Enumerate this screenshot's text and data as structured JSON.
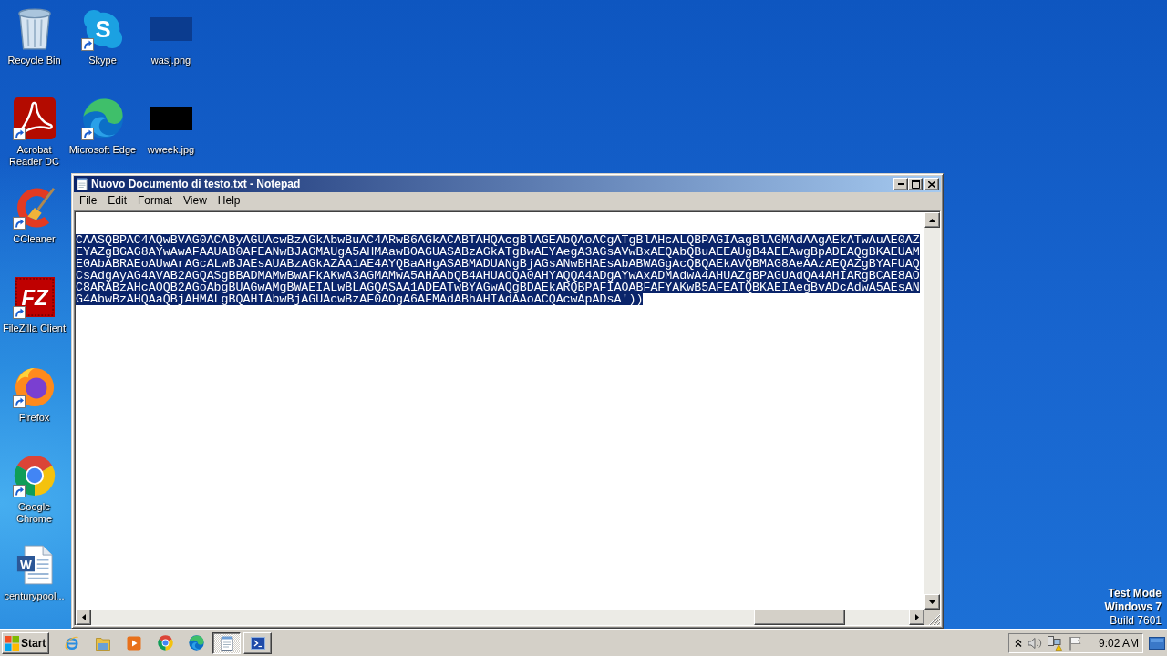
{
  "desktop": {
    "columns": [
      [
        {
          "label": "Recycle Bin",
          "kind": "bin",
          "shortcut": false
        },
        {
          "label": "Acrobat Reader DC",
          "kind": "acrobat",
          "shortcut": true
        },
        {
          "label": "CCleaner",
          "kind": "ccleaner",
          "shortcut": true
        },
        {
          "label": "FileZilla Client",
          "kind": "filezilla",
          "logo": "FZ",
          "shortcut": true
        },
        {
          "label": "Firefox",
          "kind": "firefox",
          "shortcut": true
        },
        {
          "label": "Google Chrome",
          "kind": "chrome",
          "shortcut": true
        },
        {
          "label": "centurypool...",
          "kind": "word",
          "logo": "W",
          "shortcut": false
        }
      ],
      [
        {
          "label": "Skype",
          "kind": "skype",
          "logo": "S",
          "shortcut": true
        },
        {
          "label": "Microsoft Edge",
          "kind": "edge",
          "shortcut": true
        }
      ],
      [
        {
          "label": "wasj.png",
          "kind": "image",
          "color": "#0b3c8f",
          "shortcut": false
        },
        {
          "label": "wweek.jpg",
          "kind": "image",
          "color": "#000000",
          "shortcut": false
        }
      ]
    ],
    "notice": [
      "Test Mode",
      "Windows 7",
      "Build 7601"
    ]
  },
  "window": {
    "title": "Nuovo Documento di testo.txt - Notepad",
    "menu": [
      "File",
      "Edit",
      "Format",
      "View",
      "Help"
    ],
    "document": {
      "lines": [
        {
          "text": "CAASQBPAC4AQwBVAG0ACAByAGUAcwBzAGkAbwBuAC4ARwB6AGkACABTAHQAcgBlAGEAbQAoACgATgBlAHcALQBPAGIAagBlAGMAdAAgAEkATwAuAE0AZ",
          "selected": true
        },
        {
          "text": "EYAZgBGAG8AYwAwAFAAUAB0AFEANwBJAGMAUgA5AHMAawBOAGUASABzAGkATgBwAEYAegA3AGsAVwBxAEQAbQBuAEEAUgB4AEEAwgBpADEAQgBKAEUAM",
          "selected": true
        },
        {
          "text": "E0AbABRAEoAUwArAGcALwBJAEsAUABzAGkAZAA1AE4AYQBaAHgASABMADUANgBjAGsANwBHAEsAbABWAGgAcQBQAEkAVQBMAG8AeAAzAEQAZgBYAFUAQ",
          "selected": true
        },
        {
          "text": "CsAdgAyAG4AVAB2AGQASgBBADMAMwBwAFkAKwA3AGMAMwA5AHAAbQB4AHUAOQA0AHYAQQA4ADgAYwAxADMAdwA4AHUAZgBPAGUAdQA4AHIARgBCAE8AO",
          "selected": true
        },
        {
          "text": "C8ARABzAHcAOQB2AGoAbgBUAGwAMgBWAEIALwBLAGQASAA1ADEATwBYAGwAQgBDAEkARQBPAFIAOABFAFYAKwB5AFEATQBKAEIAegBvADcAdwA5AEsAN",
          "selected": true
        },
        {
          "text": "G4AbwBzAHQAaQBjAHMALgBQAHIAbwBjAGUAcwBzAF0AOgA6AFMAdABhAHIAdAAoACQAcwApADsA'))",
          "selected": true
        }
      ]
    }
  },
  "taskbar": {
    "start": "Start",
    "quick_launch": [
      {
        "kind": "ie"
      },
      {
        "kind": "explorer"
      },
      {
        "kind": "media"
      },
      {
        "kind": "chrome"
      },
      {
        "kind": "edge"
      }
    ],
    "tasks": [
      {
        "kind": "notepad",
        "selected": true
      },
      {
        "kind": "powershell",
        "selected": false
      }
    ],
    "tray": {
      "icons": [
        {
          "kind": "chevron"
        },
        {
          "kind": "speaker"
        },
        {
          "kind": "network"
        },
        {
          "kind": "flag"
        }
      ],
      "clock": "9:02 AM"
    }
  }
}
